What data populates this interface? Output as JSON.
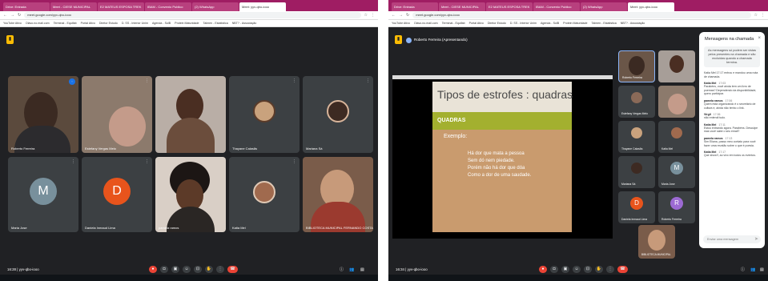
{
  "left": {
    "tabs": [
      "Drive: Entrada",
      "Meet - CIESE MUNICIPAL",
      "E2 MATEUS ESPOSA TREK",
      "IBAM - Convenio Publico",
      "(2) WhatsApp",
      "Meet: yyv-qbo-iooo"
    ],
    "address": "meet.google.com/yyv-qbo-iooo",
    "bookmarks": [
      "YouTube Ativo",
      "Olavo.no.mail.com",
      "Terminal - Equifab",
      "Portal Ativo",
      "Diretor Estudo",
      "D. SS - Interior Unim",
      "Agenda - SolB",
      "Protein Maturidade",
      "Talmen - Estatistica",
      "NBT? - Associação",
      "CDD",
      "Grade - Literatura"
    ],
    "tiles": [
      {
        "name": "Roberto Ferreira"
      },
      {
        "name": "Estefany Vergas Melo"
      },
      {
        "name": ""
      },
      {
        "name": "Thayane Calasãs"
      },
      {
        "name": "Mariana Sá"
      },
      {
        "name": "Maria Jose",
        "initial": "M"
      },
      {
        "name": "Daniela Inmaud Lima",
        "initial": "D"
      },
      {
        "name": "pamela ramos"
      },
      {
        "name": "Katia Mel"
      },
      {
        "name": "BIBLIOTECA MUNICIPAL FERNANDO COSTA"
      }
    ],
    "meeting_info": "16:28 | yyv-qbo-iooo"
  },
  "right": {
    "tabs": [
      "Drive: Entrada",
      "Meet - CIESE MUNICIPAL",
      "E2 MATEUS ESPOSA TREK",
      "IBAM - Convenio Publico",
      "(2) WhatsApp",
      "Meet: yyv-qbo-iooo"
    ],
    "address": "meet.google.com/yyv-qbo-iooo",
    "bookmarks": [
      "YouTube Ativo",
      "Olavo.no.mail.com",
      "Terminal - Equifab",
      "Portal Ativo",
      "Diretor Estudo",
      "D. SS - Interior Unim",
      "Agenda - SolB",
      "Protein Maturidade",
      "Talmen - Estatistica",
      "NBT? - Associação",
      "CDD",
      "Grade - Literatura"
    ],
    "presenter": "Roberto Ferreira (Apresentando)",
    "slide": {
      "title": "Tipos de estrofes : quadras",
      "band": "QUADRAS",
      "example": "Exemplo:",
      "lines": [
        "Há dor que mata a pessoa",
        "Sem dó nem piedade.",
        "Porém não há dor que dóa",
        "Como a dor de uma saudade."
      ]
    },
    "tiles": [
      {
        "name": "Roberto Ferreira"
      },
      {
        "name": ""
      },
      {
        "name": "Estefany Vergas Melo"
      },
      {
        "name": ""
      },
      {
        "name": "Thayane Calasãs"
      },
      {
        "name": "Katia Mel"
      },
      {
        "name": "Mariana Sá"
      },
      {
        "name": "Maria Jose",
        "initial": "M"
      },
      {
        "name": "Daniela Inmaud Lima",
        "initial": "D"
      },
      {
        "name": "Roberto Ferreira",
        "initial": "R"
      },
      {
        "name": "BIBLIOTECA MUNICIPAL"
      }
    ],
    "chat": {
      "title": "Mensagens na chamada",
      "notice": "As mensagens só podem ser vistas pelos presentes na chamada e são excluídas quando a chamada termina.",
      "first_text": "Katia Mel 17:17 entrou e mandou uma nota de chamada.",
      "messages": [
        {
          "author": "Katia Mel",
          "time": "17:03",
          "text": "Parabéns, você ainda tem um livro de poemas? Dependendo da disponibilidade, quero participar."
        },
        {
          "author": "pamela ramos",
          "time": "17:06",
          "text": "Quem está organizando é o secretário de cultura e, ainda não tenho o link."
        },
        {
          "author": "Virgil",
          "time": "17:06",
          "text": "não entendi tudo."
        },
        {
          "author": "Katia Mel",
          "time": "17:11",
          "text": "Estou entrando agora. Parabéns. Desculpe mas você sabe o seu email?"
        },
        {
          "author": "pamela ramos",
          "time": "17:13",
          "text": "Sim Eliana, passo meu contato para você fazer uma reunião sobre o que é poesia."
        },
        {
          "author": "Katia Mel",
          "time": "17:17",
          "text": "Que show!!, ao vivo em todos os eventos."
        }
      ],
      "input_placeholder": "Enviar uma mensagem"
    },
    "meeting_info": "16:34 | yyv-qbo-iooo"
  },
  "colors": {
    "meet_bg": "#202124",
    "tile_bg": "#3c4043",
    "hangup": "#ea4335",
    "browser_tabbar": "#9f1d63",
    "slide_band": "#a3b02f"
  }
}
